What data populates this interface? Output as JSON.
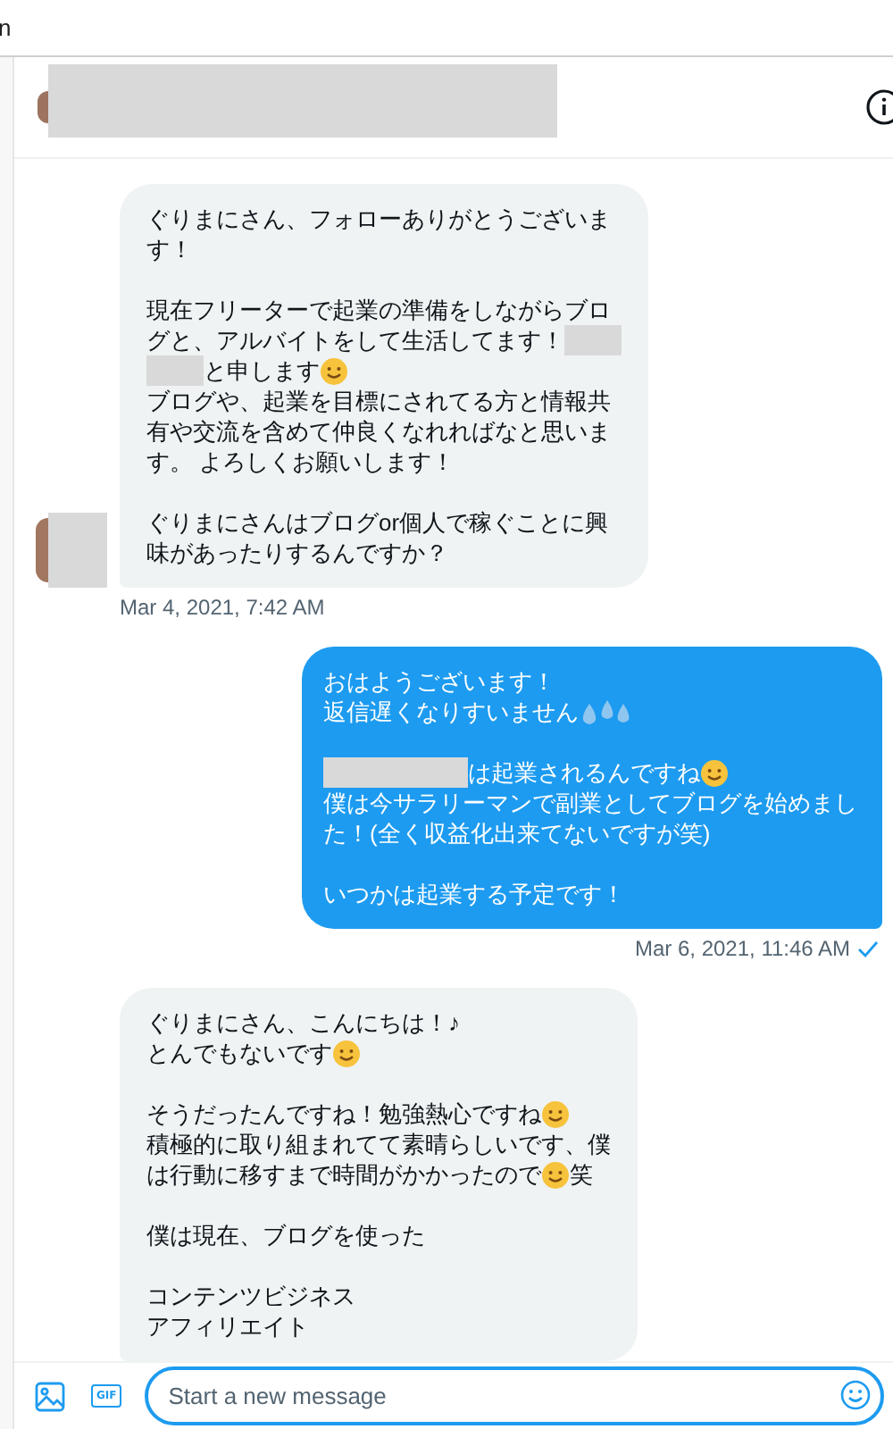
{
  "top_bar": {
    "text": "n"
  },
  "messages": [
    {
      "kind": "incoming",
      "avatar": true,
      "timestamp": "Mar 4, 2021, 7:42 AM",
      "paragraphs": [
        [
          [
            {
              "kind": "text",
              "text": "ぐりまにさん、フォローありがとうございま"
            }
          ],
          [
            {
              "kind": "text",
              "text": "す！"
            }
          ]
        ],
        [
          [
            {
              "kind": "text",
              "text": "現在フリーターで起業の準備をしながらブロ"
            }
          ],
          [
            {
              "kind": "text",
              "text": "グと、アルバイトをして生活してます！"
            },
            {
              "kind": "redacted"
            }
          ],
          [
            {
              "kind": "redacted"
            },
            {
              "kind": "text",
              "text": "と申します"
            },
            {
              "kind": "emoji"
            }
          ],
          [
            {
              "kind": "text",
              "text": "ブログや、起業を目標にされてる方と情報共"
            }
          ],
          [
            {
              "kind": "text",
              "text": "有や交流を含めて仲良くなれればなと思いま"
            }
          ],
          [
            {
              "kind": "text",
              "text": "す。 よろしくお願いします！"
            }
          ]
        ],
        [
          [
            {
              "kind": "text",
              "text": "ぐりまにさんはブログor個人で稼ぐことに興"
            }
          ],
          [
            {
              "kind": "text",
              "text": "味があったりするんですか？"
            }
          ]
        ]
      ]
    },
    {
      "kind": "outgoing",
      "avatar": false,
      "timestamp": "Mar 6, 2021, 11:46 AM",
      "paragraphs": [
        [
          [
            {
              "kind": "text",
              "text": "おはようございます！"
            }
          ],
          [
            {
              "kind": "text",
              "text": "返信遅くなりすいません"
            },
            {
              "kind": "drops"
            }
          ]
        ],
        [
          [
            {
              "kind": "redacted-wide"
            },
            {
              "kind": "text",
              "text": "は起業されるんですね"
            },
            {
              "kind": "emoji"
            }
          ],
          [
            {
              "kind": "text",
              "text": "僕は今サラリーマンで副業としてブログを始めまし"
            }
          ],
          [
            {
              "kind": "text",
              "text": "た！(全く収益化出来てないですが笑)"
            }
          ]
        ],
        [
          [
            {
              "kind": "text",
              "text": "いつかは起業する予定です！"
            }
          ]
        ]
      ]
    },
    {
      "kind": "incoming",
      "avatar": false,
      "paragraphs": [
        [
          [
            {
              "kind": "text",
              "text": "ぐりまにさん、こんにちは！♪"
            }
          ],
          [
            {
              "kind": "text",
              "text": "とんでもないです"
            },
            {
              "kind": "emoji"
            }
          ]
        ],
        [
          [
            {
              "kind": "text",
              "text": "そうだったんですね！勉強熱心ですね"
            },
            {
              "kind": "emoji"
            }
          ],
          [
            {
              "kind": "text",
              "text": "積極的に取り組まれてて素晴らしいです、僕"
            }
          ],
          [
            {
              "kind": "text",
              "text": "は行動に移すまで時間がかかったので"
            },
            {
              "kind": "emoji"
            },
            {
              "kind": "text",
              "text": "笑"
            }
          ]
        ],
        [
          [
            {
              "kind": "text",
              "text": "僕は現在、ブログを使った"
            }
          ]
        ],
        [
          [
            {
              "kind": "text",
              "text": "コンテンツビジネス"
            }
          ],
          [
            {
              "kind": "text",
              "text": "アフィリエイト"
            }
          ]
        ]
      ]
    }
  ],
  "composer": {
    "gif_label": "GIF",
    "placeholder": "Start a new message"
  }
}
